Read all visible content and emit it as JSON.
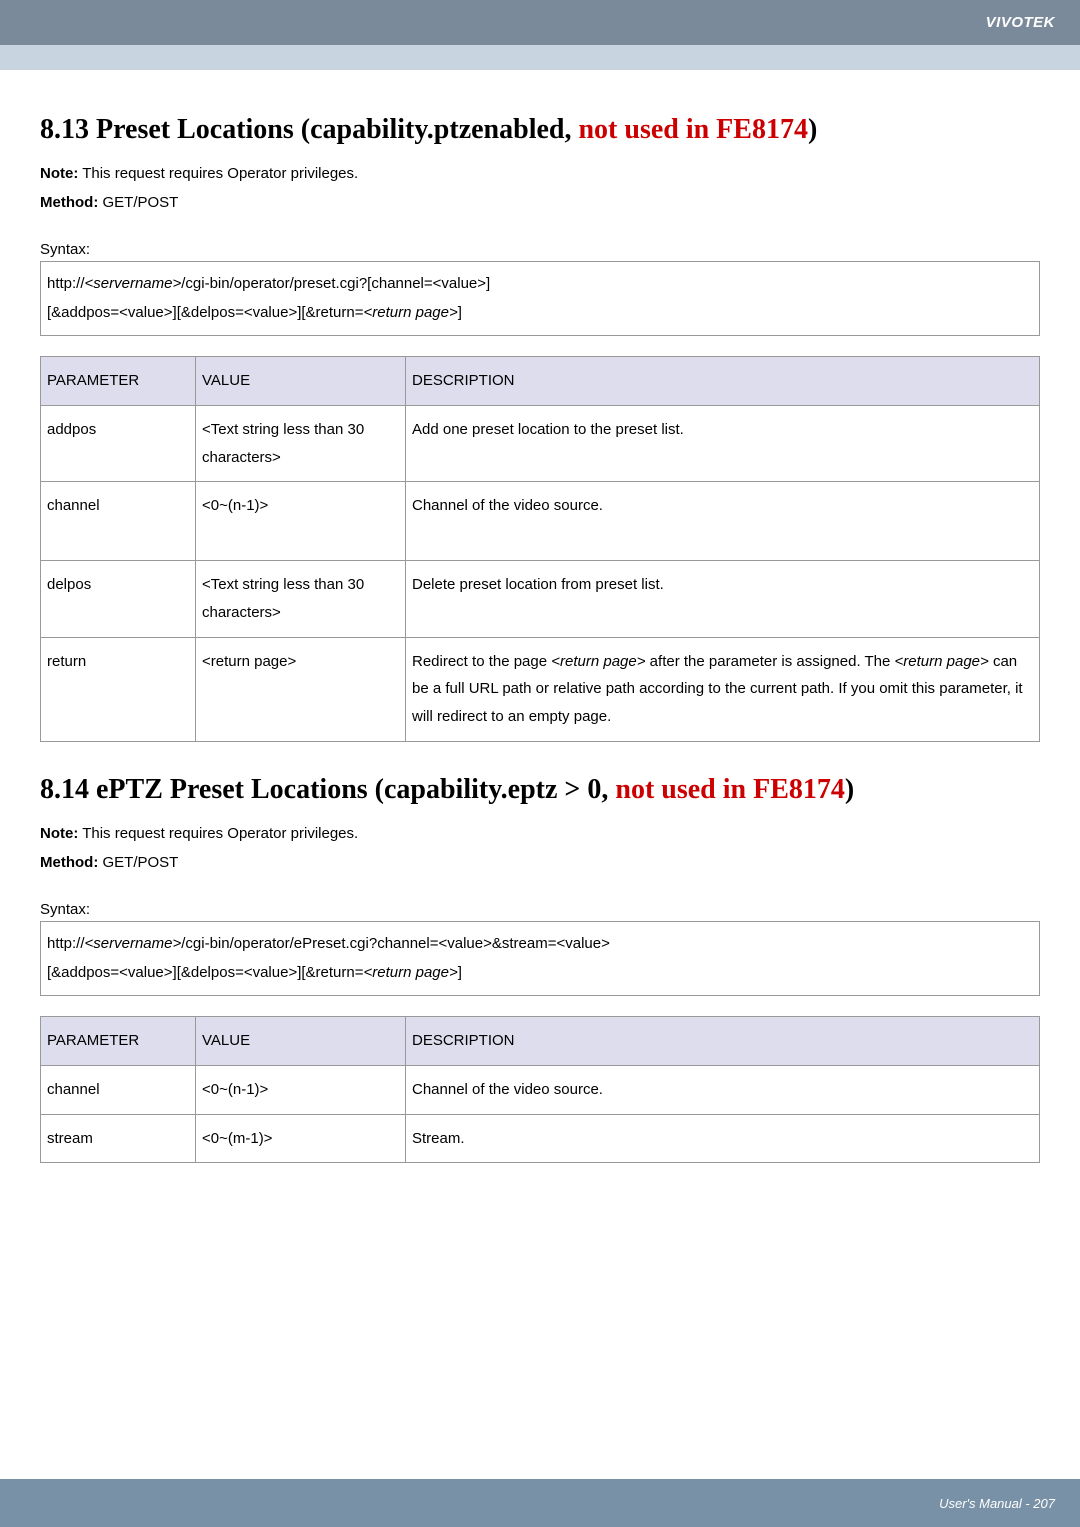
{
  "header": {
    "brand": "VIVOTEK"
  },
  "section1": {
    "heading_prefix": "8.13 Preset Locations (capability.ptzenabled, ",
    "heading_red": "not used in FE8174",
    "heading_suffix": ")",
    "note_label": "Note:",
    "note_text": " This request requires Operator privileges.",
    "method_label": "Method:",
    "method_text": " GET/POST",
    "syntax_label": "Syntax:",
    "syntax_line1_a": "http://",
    "syntax_line1_b": "<servername>",
    "syntax_line1_c": "/cgi-bin/operator/preset.cgi?[channel=<value>]",
    "syntax_line2_a": "[&addpos=<value>][&delpos=<value>][&return=",
    "syntax_line2_b": "<return page>",
    "syntax_line2_c": "]",
    "table": {
      "h1": "PARAMETER",
      "h2": "VALUE",
      "h3": "DESCRIPTION",
      "rows": [
        {
          "p": "addpos",
          "v": "<Text string less than 30 characters>",
          "d": "Add one preset location to the preset list."
        },
        {
          "p": "channel",
          "v": "<0~(n-1)>",
          "d": "Channel of the video source."
        },
        {
          "p": "delpos",
          "v": "<Text string less than 30 characters>",
          "d": "Delete preset location from preset list."
        },
        {
          "p": "return",
          "v": "<return page>",
          "d_a": "Redirect to the page ",
          "d_b": "<return page>",
          "d_c": " after the parameter is assigned. The ",
          "d_d": "<return page>",
          "d_e": " can be a full URL path or relative path according to the current path. If you omit this parameter, it will redirect to an empty page."
        }
      ]
    }
  },
  "section2": {
    "heading_prefix": "8.14 ePTZ Preset Locations (capability.eptz > 0, ",
    "heading_red": "not used in FE8174",
    "heading_suffix": ")",
    "note_label": "Note:",
    "note_text": " This request requires Operator privileges.",
    "method_label": "Method:",
    "method_text": " GET/POST",
    "syntax_label": "Syntax:",
    "syntax_line1_a": "http://",
    "syntax_line1_b": "<servername>",
    "syntax_line1_c": "/cgi-bin/operator/ePreset.cgi?channel=<value>&stream=<value>",
    "syntax_line2_a": "[&addpos=<value>][&delpos=<value>][&return=",
    "syntax_line2_b": "<return page>",
    "syntax_line2_c": "]",
    "table": {
      "h1": "PARAMETER",
      "h2": "VALUE",
      "h3": "DESCRIPTION",
      "rows": [
        {
          "p": "channel",
          "v": "<0~(n-1)>",
          "d": "Channel of the video source."
        },
        {
          "p": "stream",
          "v": "<0~(m-1)>",
          "d": "Stream."
        }
      ]
    }
  },
  "footer": {
    "text": "User's Manual - 207"
  }
}
